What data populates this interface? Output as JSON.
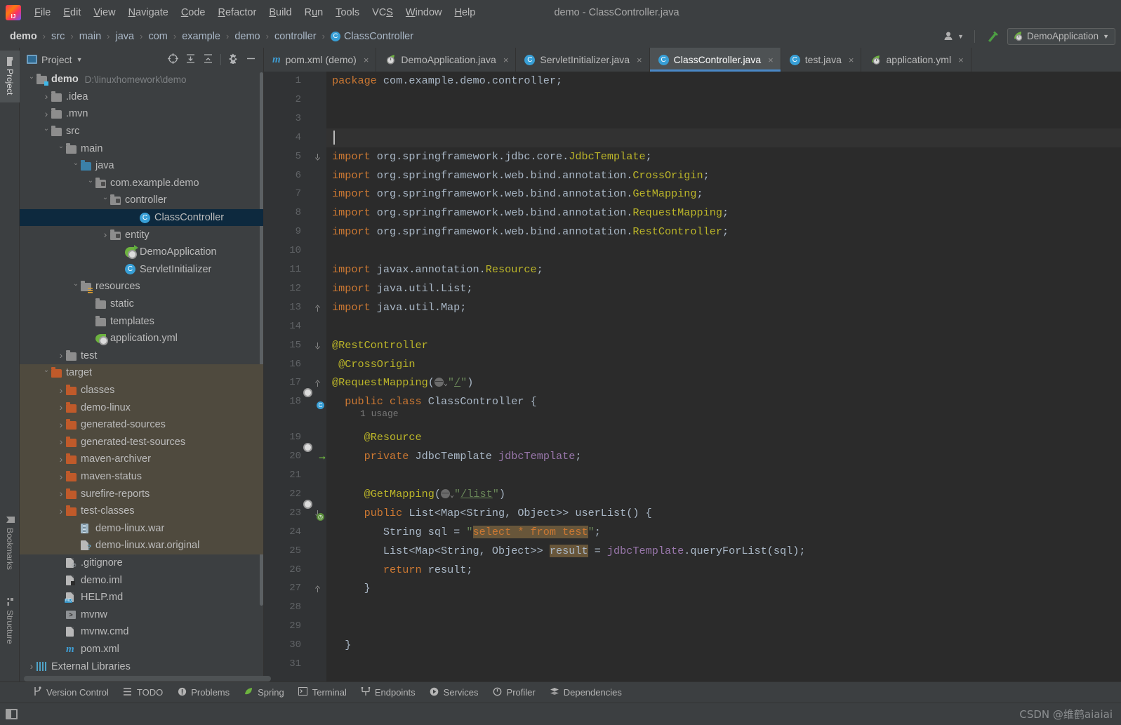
{
  "window": {
    "title": "demo - ClassController.java",
    "logo_icon": "intellij-idea-logo"
  },
  "menubar": {
    "items": [
      {
        "label": "File",
        "mnemonic": "F"
      },
      {
        "label": "Edit",
        "mnemonic": "E"
      },
      {
        "label": "View",
        "mnemonic": "V"
      },
      {
        "label": "Navigate",
        "mnemonic": "N"
      },
      {
        "label": "Code",
        "mnemonic": "C"
      },
      {
        "label": "Refactor",
        "mnemonic": "R"
      },
      {
        "label": "Build",
        "mnemonic": "B"
      },
      {
        "label": "Run",
        "mnemonic": "u"
      },
      {
        "label": "Tools",
        "mnemonic": "T"
      },
      {
        "label": "VCS",
        "mnemonic": "S"
      },
      {
        "label": "Window",
        "mnemonic": "W"
      },
      {
        "label": "Help",
        "mnemonic": "H"
      }
    ]
  },
  "navbar": {
    "breadcrumbs": [
      {
        "label": "demo",
        "icon": ""
      },
      {
        "label": "src",
        "icon": ""
      },
      {
        "label": "main",
        "icon": ""
      },
      {
        "label": "java",
        "icon": ""
      },
      {
        "label": "com",
        "icon": ""
      },
      {
        "label": "example",
        "icon": ""
      },
      {
        "label": "demo",
        "icon": ""
      },
      {
        "label": "controller",
        "icon": ""
      },
      {
        "label": "ClassController",
        "icon": "class-icon",
        "icon_letter": "C"
      }
    ],
    "separator": "›",
    "account_icon": "user-account-icon",
    "build_icon": "hammer-build-icon",
    "run_config": {
      "label": "DemoApplication",
      "icon": "spring-boot-icon",
      "chevron": "▼"
    }
  },
  "left_rail": {
    "buttons": [
      {
        "label": "Project",
        "icon": "project-folder-icon",
        "active": true
      },
      {
        "label": "Bookmarks",
        "icon": "bookmark-icon",
        "active": false
      },
      {
        "label": "Structure",
        "icon": "structure-icon",
        "active": false
      }
    ]
  },
  "project_panel": {
    "title": "Project",
    "title_chevron": "▼",
    "tools": [
      {
        "name": "select-opened-file-icon",
        "glyph": "⊕"
      },
      {
        "name": "expand-all-icon",
        "glyph": "⤓"
      },
      {
        "name": "collapse-all-icon",
        "glyph": "⤒"
      },
      {
        "name": "settings-gear-icon",
        "glyph": "⚙"
      },
      {
        "name": "hide-panel-icon",
        "glyph": "—"
      }
    ],
    "tree": [
      {
        "label": "demo",
        "suffix": "D:\\linuxhomework\\demo",
        "indent": 0,
        "arrow": "open",
        "icon": "folder-module",
        "bold": true,
        "state": "normal"
      },
      {
        "label": ".idea",
        "indent": 1,
        "arrow": "closed",
        "icon": "folder",
        "state": "normal"
      },
      {
        "label": ".mvn",
        "indent": 1,
        "arrow": "closed",
        "icon": "folder",
        "state": "normal"
      },
      {
        "label": "src",
        "indent": 1,
        "arrow": "open",
        "icon": "folder",
        "state": "normal"
      },
      {
        "label": "main",
        "indent": 2,
        "arrow": "open",
        "icon": "folder",
        "state": "normal"
      },
      {
        "label": "java",
        "indent": 3,
        "arrow": "open",
        "icon": "folder-source",
        "state": "normal"
      },
      {
        "label": "com.example.demo",
        "indent": 4,
        "arrow": "open",
        "icon": "folder-package",
        "state": "normal"
      },
      {
        "label": "controller",
        "indent": 5,
        "arrow": "open",
        "icon": "folder-package",
        "state": "normal"
      },
      {
        "label": "ClassController",
        "indent": 7,
        "arrow": "none",
        "icon": "java-class",
        "state": "selected"
      },
      {
        "label": "entity",
        "indent": 5,
        "arrow": "closed",
        "icon": "folder-package",
        "state": "normal"
      },
      {
        "label": "DemoApplication",
        "indent": 6,
        "arrow": "none",
        "icon": "spring-boot-class",
        "state": "normal"
      },
      {
        "label": "ServletInitializer",
        "indent": 6,
        "arrow": "none",
        "icon": "java-class",
        "state": "normal"
      },
      {
        "label": "resources",
        "indent": 3,
        "arrow": "open",
        "icon": "folder-resources",
        "state": "normal"
      },
      {
        "label": "static",
        "indent": 4,
        "arrow": "none",
        "icon": "folder",
        "state": "normal"
      },
      {
        "label": "templates",
        "indent": 4,
        "arrow": "none",
        "icon": "folder",
        "state": "normal"
      },
      {
        "label": "application.yml",
        "indent": 4,
        "arrow": "none",
        "icon": "spring-yml",
        "state": "normal"
      },
      {
        "label": "test",
        "indent": 2,
        "arrow": "closed",
        "icon": "folder",
        "state": "normal"
      },
      {
        "label": "target",
        "indent": 1,
        "arrow": "open",
        "icon": "folder-excluded",
        "state": "excluded"
      },
      {
        "label": "classes",
        "indent": 2,
        "arrow": "closed",
        "icon": "folder-excluded",
        "state": "excluded"
      },
      {
        "label": "demo-linux",
        "indent": 2,
        "arrow": "closed",
        "icon": "folder-excluded",
        "state": "excluded"
      },
      {
        "label": "generated-sources",
        "indent": 2,
        "arrow": "closed",
        "icon": "folder-excluded",
        "state": "excluded"
      },
      {
        "label": "generated-test-sources",
        "indent": 2,
        "arrow": "closed",
        "icon": "folder-excluded",
        "state": "excluded"
      },
      {
        "label": "maven-archiver",
        "indent": 2,
        "arrow": "closed",
        "icon": "folder-excluded",
        "state": "excluded"
      },
      {
        "label": "maven-status",
        "indent": 2,
        "arrow": "closed",
        "icon": "folder-excluded",
        "state": "excluded"
      },
      {
        "label": "surefire-reports",
        "indent": 2,
        "arrow": "closed",
        "icon": "folder-excluded",
        "state": "excluded"
      },
      {
        "label": "test-classes",
        "indent": 2,
        "arrow": "closed",
        "icon": "folder-excluded",
        "state": "excluded"
      },
      {
        "label": "demo-linux.war",
        "indent": 3,
        "arrow": "none",
        "icon": "war-archive",
        "state": "excluded"
      },
      {
        "label": "demo-linux.war.original",
        "indent": 3,
        "arrow": "none",
        "icon": "unknown-file",
        "state": "excluded"
      },
      {
        "label": ".gitignore",
        "indent": 2,
        "arrow": "none",
        "icon": "gitignore-file",
        "state": "normal"
      },
      {
        "label": "demo.iml",
        "indent": 2,
        "arrow": "none",
        "icon": "iml-file",
        "state": "normal"
      },
      {
        "label": "HELP.md",
        "indent": 2,
        "arrow": "none",
        "icon": "markdown-file",
        "state": "normal"
      },
      {
        "label": "mvnw",
        "indent": 2,
        "arrow": "none",
        "icon": "script-file",
        "state": "normal"
      },
      {
        "label": "mvnw.cmd",
        "indent": 2,
        "arrow": "none",
        "icon": "cmd-file",
        "state": "normal"
      },
      {
        "label": "pom.xml",
        "indent": 2,
        "arrow": "none",
        "icon": "maven-file",
        "state": "normal"
      },
      {
        "label": "External Libraries",
        "indent": 0,
        "arrow": "closed",
        "icon": "libraries-icon",
        "state": "normal"
      }
    ]
  },
  "tabs": [
    {
      "label": "pom.xml (demo)",
      "icon": "maven-icon",
      "active": false,
      "close": "×"
    },
    {
      "label": "DemoApplication.java",
      "icon": "spring-boot-icon",
      "active": false,
      "close": "×"
    },
    {
      "label": "ServletInitializer.java",
      "icon": "java-class-icon",
      "active": false,
      "close": "×"
    },
    {
      "label": "ClassController.java",
      "icon": "java-class-icon",
      "active": true,
      "close": "×"
    },
    {
      "label": "test.java",
      "icon": "java-class-icon",
      "active": false,
      "close": "×"
    },
    {
      "label": "application.yml",
      "icon": "spring-yml-icon",
      "active": false,
      "close": "×"
    }
  ],
  "editor": {
    "file": "ClassController.java",
    "caret_line": 4,
    "line_numbers": [
      1,
      2,
      3,
      4,
      5,
      6,
      7,
      8,
      9,
      10,
      11,
      12,
      13,
      14,
      15,
      16,
      17,
      18,
      19,
      20,
      21,
      22,
      23,
      24,
      25,
      26,
      27,
      28,
      29,
      30,
      31
    ],
    "inlay_hint": "1 usage",
    "lines": [
      {
        "n": 1,
        "text": "package com.example.demo.controller;"
      },
      {
        "n": 2,
        "text": ""
      },
      {
        "n": 3,
        "text": ""
      },
      {
        "n": 4,
        "text": ""
      },
      {
        "n": 5,
        "text": "import org.springframework.jdbc.core.JdbcTemplate;"
      },
      {
        "n": 6,
        "text": "import org.springframework.web.bind.annotation.CrossOrigin;"
      },
      {
        "n": 7,
        "text": "import org.springframework.web.bind.annotation.GetMapping;"
      },
      {
        "n": 8,
        "text": "import org.springframework.web.bind.annotation.RequestMapping;"
      },
      {
        "n": 9,
        "text": "import org.springframework.web.bind.annotation.RestController;"
      },
      {
        "n": 10,
        "text": ""
      },
      {
        "n": 11,
        "text": "import javax.annotation.Resource;"
      },
      {
        "n": 12,
        "text": "import java.util.List;"
      },
      {
        "n": 13,
        "text": "import java.util.Map;"
      },
      {
        "n": 14,
        "text": ""
      },
      {
        "n": 15,
        "text": "@RestController"
      },
      {
        "n": 16,
        "text": "@CrossOrigin"
      },
      {
        "n": 17,
        "text": "@RequestMapping(\"/\")"
      },
      {
        "n": 18,
        "text": "public class ClassController {"
      },
      {
        "n": 19,
        "text": "    @Resource"
      },
      {
        "n": 20,
        "text": "    private JdbcTemplate jdbcTemplate;"
      },
      {
        "n": 21,
        "text": ""
      },
      {
        "n": 22,
        "text": "    @GetMapping(\"/list\")"
      },
      {
        "n": 23,
        "text": "    public List<Map<String, Object>> userList() {"
      },
      {
        "n": 24,
        "text": "        String sql = \"select * from test\";"
      },
      {
        "n": 25,
        "text": "        List<Map<String, Object>> result = jdbcTemplate.queryForList(sql);"
      },
      {
        "n": 26,
        "text": "        return result;"
      },
      {
        "n": 27,
        "text": "    }"
      },
      {
        "n": 28,
        "text": ""
      },
      {
        "n": 29,
        "text": ""
      },
      {
        "n": 30,
        "text": "}"
      },
      {
        "n": 31,
        "text": ""
      }
    ]
  },
  "statusbar": {
    "items": [
      {
        "label": "Version Control",
        "icon": "branch-icon",
        "glyph": "⑂"
      },
      {
        "label": "TODO",
        "icon": "todo-list-icon",
        "glyph": "☰"
      },
      {
        "label": "Problems",
        "icon": "problems-warning-icon",
        "glyph": "❶"
      },
      {
        "label": "Spring",
        "icon": "spring-leaf-icon",
        "glyph": "🌿"
      },
      {
        "label": "Terminal",
        "icon": "terminal-icon",
        "glyph": "▣"
      },
      {
        "label": "Endpoints",
        "icon": "endpoints-icon",
        "glyph": "⑂"
      },
      {
        "label": "Services",
        "icon": "services-play-icon",
        "glyph": "▶"
      },
      {
        "label": "Profiler",
        "icon": "profiler-icon",
        "glyph": "◷"
      },
      {
        "label": "Dependencies",
        "icon": "dependencies-icon",
        "glyph": "❖"
      }
    ]
  },
  "footer": {
    "watermark": "CSDN @维鹤aiaiai",
    "panel_icon": "toggle-tool-window-icon"
  },
  "colors": {
    "chrome_bg": "#3c3f41",
    "editor_bg": "#2b2b2b",
    "gutter_bg": "#313335",
    "selection_blue": "#0d293e",
    "excluded_olive": "#4f4a3e",
    "tab_active": "#4e5254",
    "tab_underline": "#4a88c7",
    "keyword_orange": "#cc7832",
    "string_green": "#6a8759",
    "annotation_yellow": "#bbb529",
    "field_purple": "#9876aa",
    "text_default": "#a9b7c6",
    "accent_blue": "#389fd6",
    "spring_green": "#6db33f"
  }
}
